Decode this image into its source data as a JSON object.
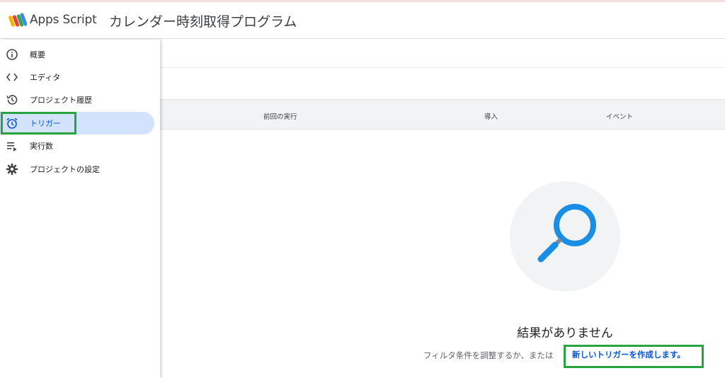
{
  "header": {
    "app_name": "Apps Script",
    "project_title": "カレンダー時刻取得プログラム"
  },
  "sidebar": {
    "items": [
      {
        "label": "概要",
        "icon": "info-icon"
      },
      {
        "label": "エディタ",
        "icon": "code-icon"
      },
      {
        "label": "プロジェクト履歴",
        "icon": "history-icon"
      },
      {
        "label": "トリガー",
        "icon": "alarm-clock-icon",
        "active": true
      },
      {
        "label": "実行数",
        "icon": "executions-icon"
      },
      {
        "label": "プロジェクトの設定",
        "icon": "gear-icon"
      }
    ]
  },
  "table": {
    "columns": [
      "前回の実行",
      "導入",
      "イベント"
    ]
  },
  "empty_state": {
    "title": "結果がありません",
    "description": "フィルタ条件を調整するか、または",
    "link": "新しいトリガーを作成します。",
    "icon": "magnifier-icon"
  },
  "colors": {
    "active_bg": "#d3e3fd",
    "active_text": "#0b57d0",
    "highlight_box": "#27a43f",
    "magnifier": "#1a8ee5"
  }
}
